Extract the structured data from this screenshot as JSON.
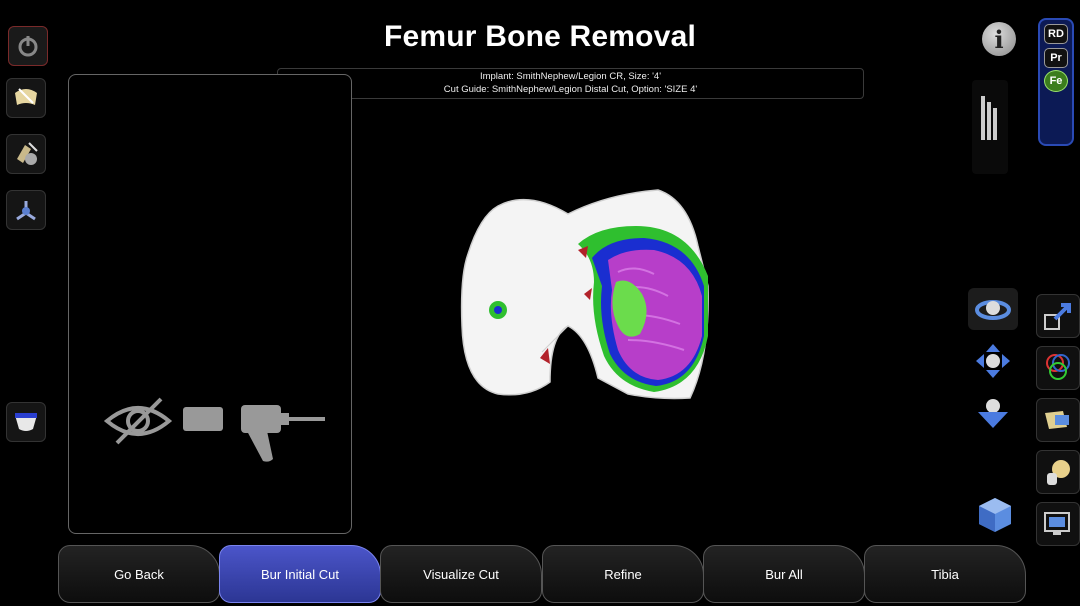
{
  "header": {
    "title": "Femur Bone Removal"
  },
  "info": {
    "implant_line": "Implant:  SmithNephew/Legion CR, Size:  '4'",
    "cut_guide_line": "Cut Guide:  SmithNephew/Legion Distal Cut, Option:  'SIZE 4'"
  },
  "mode_panel": {
    "rd": "RD",
    "pr": "Pr",
    "fe": "Fe",
    "active": "Fe"
  },
  "info_button": {
    "label": "i"
  },
  "nav": {
    "go_back": "Go Back",
    "bur_initial_cut": "Bur Initial Cut",
    "visualize_cut": "Visualize Cut",
    "refine": "Refine",
    "bur_all": "Bur All",
    "tibia": "Tibia",
    "active": "Bur Initial Cut"
  },
  "left_toolbar": [
    "power-icon",
    "femur-implant-icon",
    "instrument-icon",
    "axis-icon",
    "tibia-insert-icon"
  ],
  "right_toolbar": [
    "rotate-view-icon",
    "pan-view-icon",
    "zoom-view-icon",
    "resize-icon",
    "color-rings-icon",
    "bone-segment-icon",
    "femur-knob-icon",
    "screenshot-icon",
    "cube-view-icon"
  ],
  "side_panel": {
    "icons": [
      "eye-hidden-icon",
      "drill-handpiece-icon"
    ]
  },
  "colors": {
    "active_nav": "#3a44b0",
    "accent_green": "#3b7d1d",
    "mode_panel": "#0c1a55",
    "planned_cut": "#b73ec9"
  }
}
